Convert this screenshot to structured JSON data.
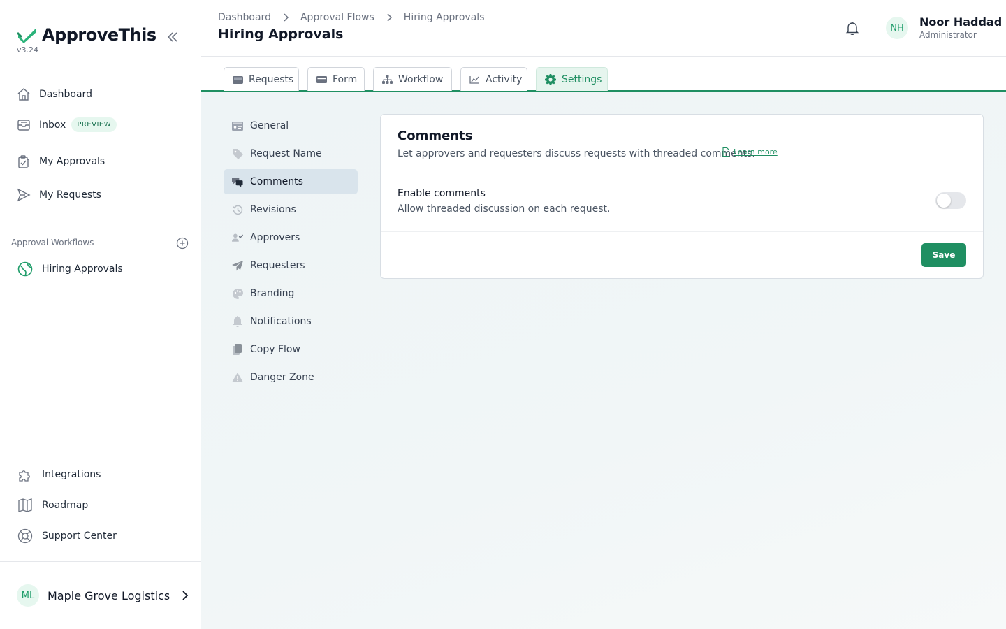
{
  "app": {
    "name": "ApproveThis",
    "version": "v3.24",
    "accent_color": "#1f8f62",
    "logo_color": "#2bb37a"
  },
  "sidebar": {
    "items": [
      {
        "label": "Dashboard",
        "icon": "home-icon"
      },
      {
        "label": "Inbox",
        "icon": "inbox-icon",
        "badge": "PREVIEW"
      },
      {
        "label": "My Approvals",
        "icon": "clipboard-check-icon"
      },
      {
        "label": "My Requests",
        "icon": "send-icon"
      }
    ],
    "workflows_title": "Approval Workflows",
    "workflows": [
      {
        "label": "Hiring Approvals",
        "icon": "globe-icon"
      }
    ],
    "footer_items": [
      {
        "label": "Integrations",
        "icon": "puzzle-icon"
      },
      {
        "label": "Roadmap",
        "icon": "map-icon"
      },
      {
        "label": "Support Center",
        "icon": "lifebuoy-icon"
      }
    ],
    "org": {
      "initials": "ML",
      "name": "Maple Grove Logistics"
    }
  },
  "header": {
    "breadcrumbs": [
      "Dashboard",
      "Approval Flows",
      "Hiring Approvals"
    ],
    "title": "Hiring Approvals",
    "user": {
      "initials": "NH",
      "name": "Noor Haddad",
      "role": "Administrator"
    }
  },
  "tabs": [
    {
      "label": "Requests",
      "icon": "inbox-tray-icon"
    },
    {
      "label": "Form",
      "icon": "form-icon"
    },
    {
      "label": "Workflow",
      "icon": "sitemap-icon"
    },
    {
      "label": "Activity",
      "icon": "chart-line-icon"
    },
    {
      "label": "Settings",
      "icon": "gear-icon",
      "active": true
    }
  ],
  "settings_nav": [
    {
      "label": "General",
      "icon": "id-card-icon"
    },
    {
      "label": "Request Name",
      "icon": "tag-icon"
    },
    {
      "label": "Comments",
      "icon": "comments-icon",
      "active": true
    },
    {
      "label": "Revisions",
      "icon": "history-icon"
    },
    {
      "label": "Approvers",
      "icon": "user-check-icon"
    },
    {
      "label": "Requesters",
      "icon": "paper-plane-icon"
    },
    {
      "label": "Branding",
      "icon": "palette-icon"
    },
    {
      "label": "Notifications",
      "icon": "bell-icon"
    },
    {
      "label": "Copy Flow",
      "icon": "copy-icon"
    },
    {
      "label": "Danger Zone",
      "icon": "warning-icon"
    }
  ],
  "comments_card": {
    "title": "Comments",
    "description": "Let approvers and requesters discuss requests with threaded comments.",
    "learn_more": "Learn more",
    "setting_label": "Enable comments",
    "setting_help": "Allow threaded discussion on each request.",
    "enabled": false,
    "save_label": "Save"
  }
}
